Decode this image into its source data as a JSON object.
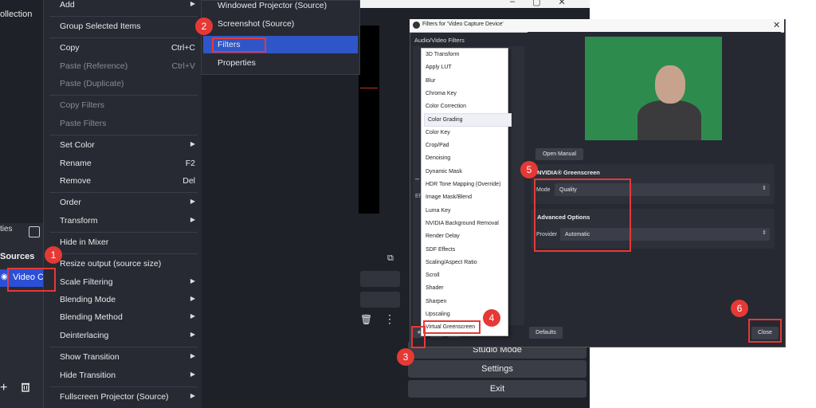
{
  "background": {
    "collection_label": "ollection",
    "properties_tab": "ties",
    "sources_header": "Sources",
    "source_name": "Video Ca",
    "buttons": [
      "Studio Mode",
      "Settings",
      "Exit"
    ]
  },
  "context_menu": {
    "items": [
      {
        "label": "Add",
        "shortcut": "",
        "submenu": true,
        "disabled": false
      },
      {
        "label": "Group Selected Items",
        "shortcut": "",
        "submenu": false,
        "disabled": false
      },
      {
        "label": "Copy",
        "shortcut": "Ctrl+C",
        "submenu": false,
        "disabled": false
      },
      {
        "label": "Paste (Reference)",
        "shortcut": "Ctrl+V",
        "submenu": false,
        "disabled": true
      },
      {
        "label": "Paste (Duplicate)",
        "shortcut": "",
        "submenu": false,
        "disabled": true
      },
      {
        "label": "Copy Filters",
        "shortcut": "",
        "submenu": false,
        "disabled": true
      },
      {
        "label": "Paste Filters",
        "shortcut": "",
        "submenu": false,
        "disabled": true
      },
      {
        "label": "Set Color",
        "shortcut": "",
        "submenu": true,
        "disabled": false
      },
      {
        "label": "Rename",
        "shortcut": "F2",
        "submenu": false,
        "disabled": false
      },
      {
        "label": "Remove",
        "shortcut": "Del",
        "submenu": false,
        "disabled": false
      },
      {
        "label": "Order",
        "shortcut": "",
        "submenu": true,
        "disabled": false
      },
      {
        "label": "Transform",
        "shortcut": "",
        "submenu": true,
        "disabled": false
      },
      {
        "label": "Hide in Mixer",
        "shortcut": "",
        "submenu": false,
        "disabled": false
      },
      {
        "label": "Resize output (source size)",
        "shortcut": "",
        "submenu": false,
        "disabled": false
      },
      {
        "label": "Scale Filtering",
        "shortcut": "",
        "submenu": true,
        "disabled": false
      },
      {
        "label": "Blending Mode",
        "shortcut": "",
        "submenu": true,
        "disabled": false
      },
      {
        "label": "Blending Method",
        "shortcut": "",
        "submenu": true,
        "disabled": false
      },
      {
        "label": "Deinterlacing",
        "shortcut": "",
        "submenu": true,
        "disabled": false
      },
      {
        "label": "Show Transition",
        "shortcut": "",
        "submenu": true,
        "disabled": false
      },
      {
        "label": "Hide Transition",
        "shortcut": "",
        "submenu": true,
        "disabled": false
      },
      {
        "label": "Fullscreen Projector (Source)",
        "shortcut": "",
        "submenu": true,
        "disabled": false
      }
    ]
  },
  "submenu": {
    "items": [
      "Windowed Projector (Source)",
      "Screenshot (Source)",
      "Filters",
      "Properties"
    ],
    "selected": "Filters"
  },
  "dialog": {
    "title": "Filters for 'Video Capture Device'",
    "av_filters_label": "Audio/Video Filters",
    "effect_label": "Eff",
    "dropdown_items": [
      "3D Transform",
      "Apply LUT",
      "Blur",
      "Chroma Key",
      "Color Correction",
      "Color Grading",
      "Color Key",
      "Crop/Pad",
      "Denoising",
      "Dynamic Mask",
      "HDR Tone Mapping (Override)",
      "Image Mask/Blend",
      "Luma Key",
      "NVIDIA Background Removal",
      "Render Delay",
      "SDF Effects",
      "Scaling/Aspect Ratio",
      "Scroll",
      "Shader",
      "Sharpen",
      "Upscaling",
      "Virtual Greenscreen"
    ],
    "hovered_item": "Color Grading",
    "open_manual": "Open Manual",
    "green_heading": "NVIDIA® Greenscreen",
    "mode_label": "Mode",
    "mode_value": "Quality",
    "advanced_heading": "Advanced Options",
    "provider_label": "Provider",
    "provider_value": "Automatic",
    "defaults": "Defaults",
    "close": "Close",
    "add_symbol": "+"
  },
  "annotations": [
    "1",
    "2",
    "3",
    "4",
    "5",
    "6"
  ],
  "colors": {
    "highlight": "#2f56c8",
    "annotation": "#e53935",
    "green_screen": "#2e8b4e"
  }
}
